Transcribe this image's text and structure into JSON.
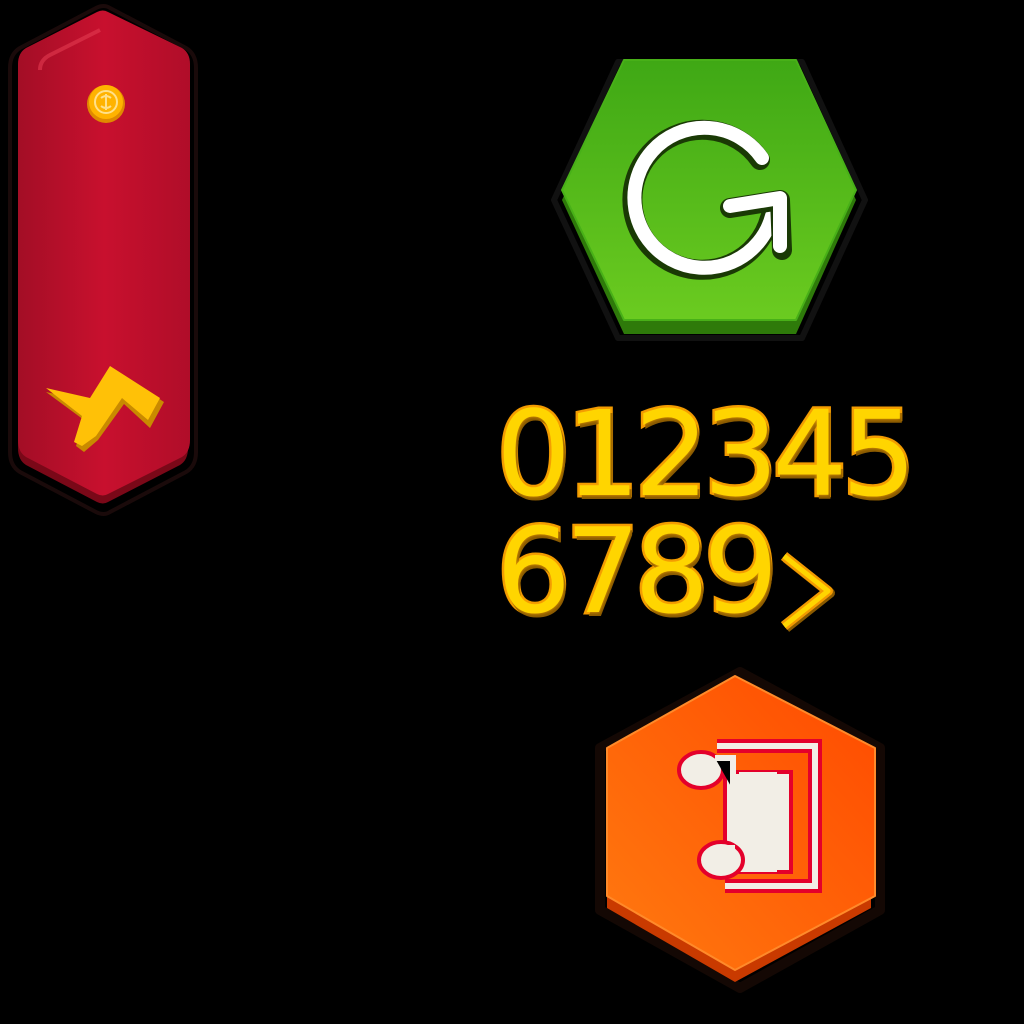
{
  "sprite_sheet": {
    "energy_panel": {
      "coin_icon": "coin-dollar-icon",
      "bolt_icon": "lightning-bolt-icon",
      "colors": {
        "panel": "#C8102E",
        "panel_dark": "#8E0A1E",
        "coin": "#FFB300",
        "bolt": "#FFC107"
      }
    },
    "restart_button": {
      "icon": "restart-arrow-icon",
      "colors": {
        "face": "#4CB81A",
        "face_light": "#6BD12A",
        "edge": "#2E7A0A",
        "icon": "#FFFFFF"
      }
    },
    "digit_font": {
      "row1": "012345",
      "row2": "6789",
      "extra_glyph": "chevron-right-icon",
      "colors": {
        "fill": "#FFD500",
        "stroke": "#F39A00"
      }
    },
    "music_button": {
      "icon": "music-note-icon",
      "colors": {
        "face": "#FF5A0A",
        "face_light": "#FF7A1A",
        "edge": "#C93A00",
        "icon": "#F2EEE6",
        "icon_outline": "#E4002B"
      }
    }
  }
}
